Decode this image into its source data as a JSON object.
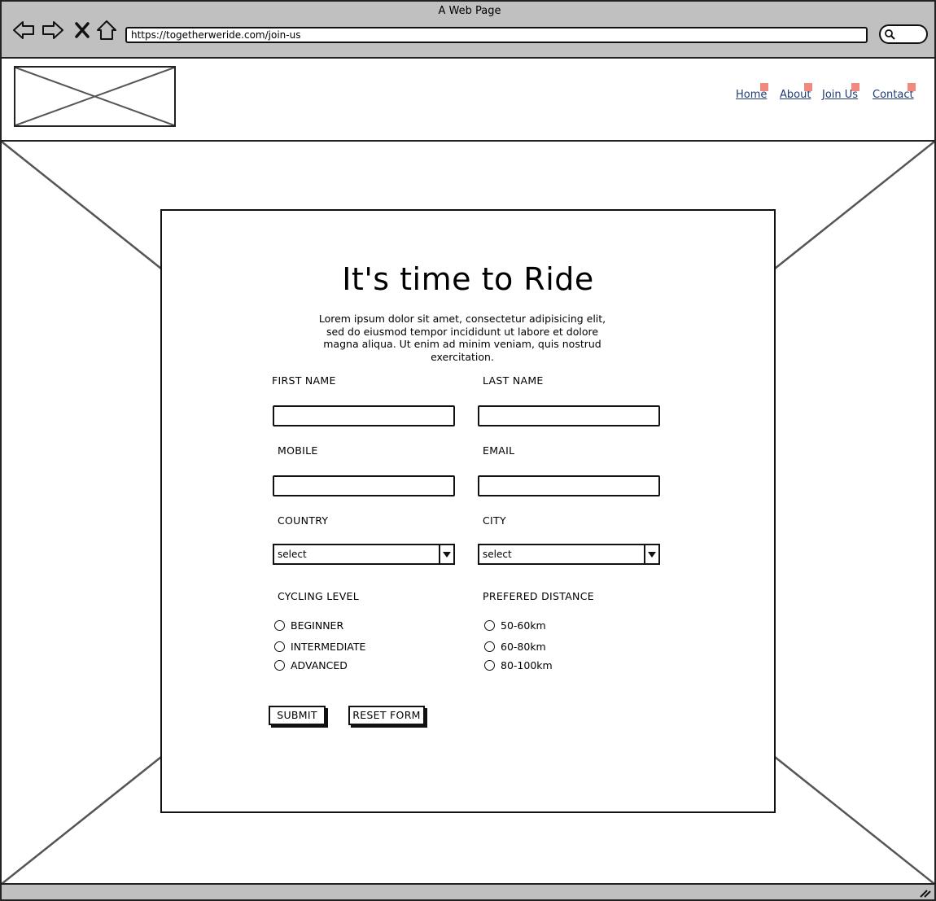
{
  "window": {
    "title": "A Web Page"
  },
  "browser": {
    "url": "https://togetherweride.com/join-us",
    "buttons": [
      "back-arrow-icon",
      "forward-arrow-icon",
      "close-icon",
      "home-icon"
    ],
    "search_icon": "search-icon"
  },
  "header": {
    "logo": "image-placeholder",
    "nav": [
      {
        "label": "Home"
      },
      {
        "label": "About"
      },
      {
        "label": "Join Us"
      },
      {
        "label": "Contact"
      }
    ]
  },
  "form": {
    "title": "It's time to Ride",
    "intro": "Lorem ipsum dolor sit amet, consectetur adipisicing elit, sed do eiusmod tempor incididunt ut labore et dolore magna aliqua. Ut enim ad minim veniam, quis nostrud exercitation.",
    "fields": {
      "first_name": {
        "label": "FIRST NAME",
        "value": ""
      },
      "last_name": {
        "label": "LAST NAME",
        "value": ""
      },
      "mobile": {
        "label": "MOBILE",
        "value": ""
      },
      "email": {
        "label": "EMAIL",
        "value": ""
      },
      "country": {
        "label": "COUNTRY",
        "selected": "select"
      },
      "city": {
        "label": "CITY",
        "selected": "select"
      }
    },
    "cycling_level": {
      "label": "CYCLING LEVEL",
      "options": [
        "BEGINNER",
        "INTERMEDIATE",
        "ADVANCED"
      ]
    },
    "preferred_distance": {
      "label": "PREFERED DISTANCE",
      "options": [
        "50-60km",
        "60-80km",
        "80-100km"
      ]
    },
    "buttons": {
      "submit": "SUBMIT",
      "reset": "RESET FORM"
    }
  }
}
